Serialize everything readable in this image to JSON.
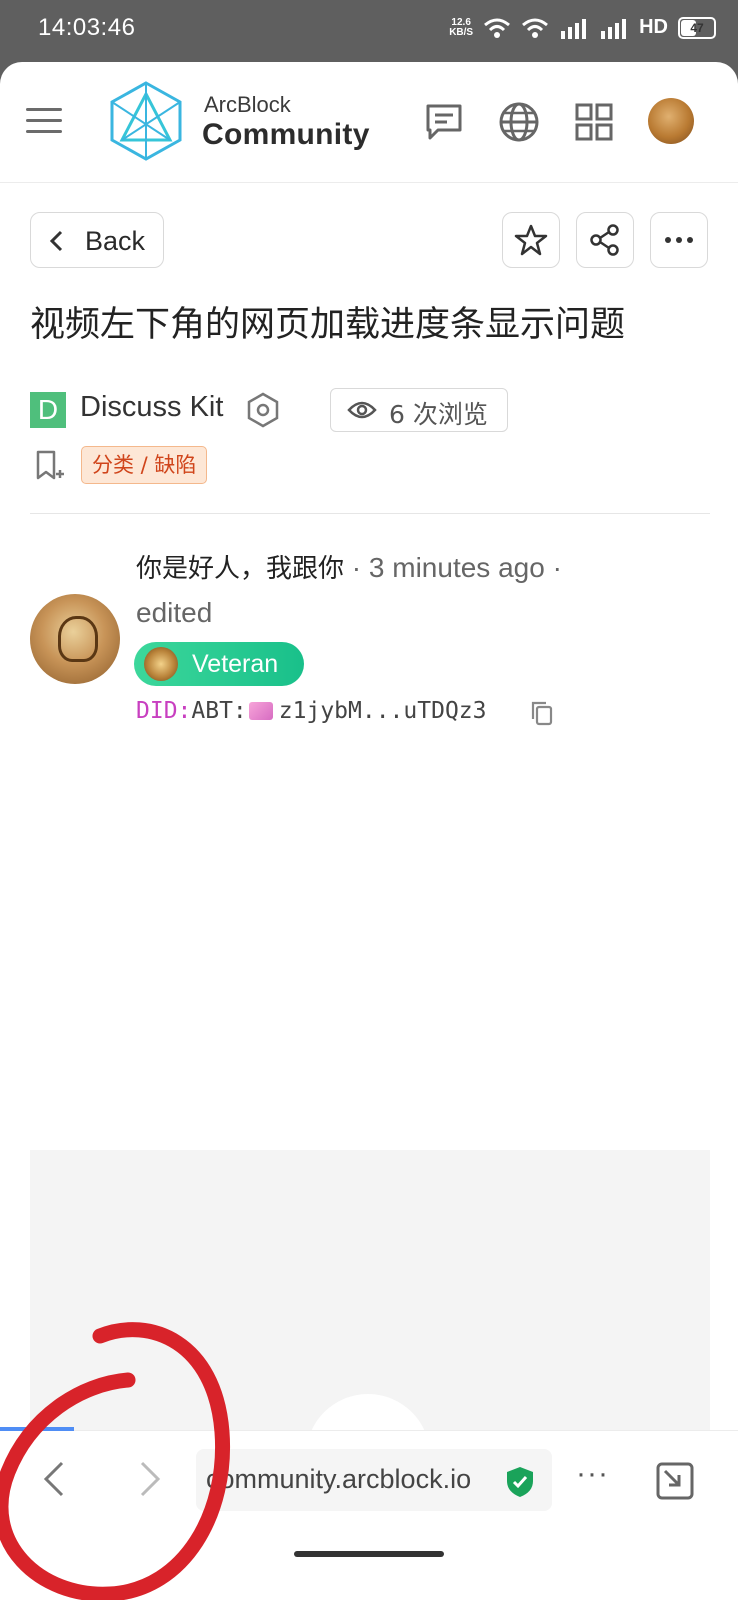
{
  "status_bar": {
    "time": "14:03:46",
    "net_speed_value": "12.6",
    "net_speed_unit": "KB/S",
    "hd_label": "HD",
    "battery": "47"
  },
  "header": {
    "brand_top": "ArcBlock",
    "brand_bottom": "Community",
    "icons": [
      "menu-icon",
      "chat-icon",
      "globe-icon",
      "apps-grid-icon",
      "avatar"
    ]
  },
  "toolbar": {
    "back_label": "Back",
    "actions": [
      "star-icon",
      "share-icon",
      "more-icon"
    ]
  },
  "post": {
    "title": "视频左下角的网页加载进度条显示问题",
    "kit_letter": "D",
    "kit_name": "Discuss Kit",
    "views": "6 次浏览",
    "tag": "分类 / 缺陷"
  },
  "author": {
    "name": "你是好人，我跟你",
    "time": "3 minutes ago",
    "edited": "edited",
    "sep": "·",
    "badge": "Veteran",
    "did_prefix": "DID:",
    "did_chain": "ABT:",
    "did_value": "z1jybM...uTDQz3"
  },
  "browser": {
    "url": "community.arcblock.io",
    "more": "···",
    "progress": 0.1
  },
  "colors": {
    "accent_green": "#19c08a",
    "tag_text": "#d0451b",
    "did_prefix": "#c83fc0",
    "progress_blue": "#4f8df5",
    "annotation_red": "#d8232a"
  }
}
